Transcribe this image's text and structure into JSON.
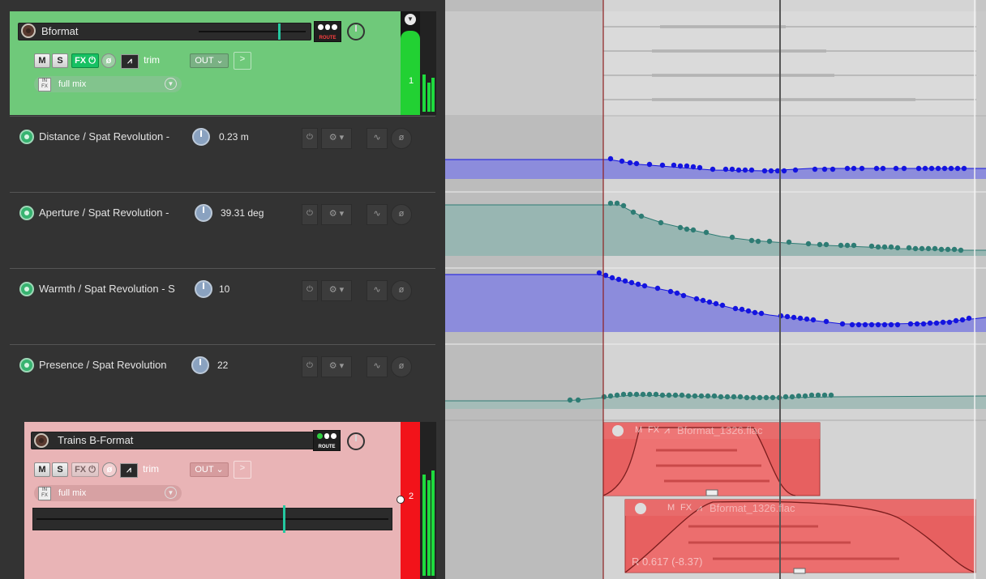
{
  "tracks": [
    {
      "name": "Bformat",
      "number": "1",
      "buttons": {
        "mute": "M",
        "solo": "S",
        "fx": "FX",
        "trim": "trim",
        "out": "OUT"
      },
      "route_label": "ROUTE",
      "fx_chain": "full mix",
      "fx_chip_label": "IN FX",
      "color": "#6fc97a",
      "fx_active": true
    },
    {
      "name": "Trains B-Format",
      "number": "2",
      "buttons": {
        "mute": "M",
        "solo": "S",
        "fx": "FX",
        "trim": "trim",
        "out": "OUT"
      },
      "route_label": "ROUTE",
      "fx_chain": "full mix",
      "fx_chip_label": "IN FX",
      "color": "#e9b4b6",
      "fx_active": false
    }
  ],
  "envelopes": [
    {
      "name": "Distance / Spat Revolution -",
      "value": "0.23 m"
    },
    {
      "name": "Aperture / Spat Revolution -",
      "value": "39.31 deg"
    },
    {
      "name": "Warmth / Spat Revolution - S",
      "value": "10"
    },
    {
      "name": "Presence / Spat Revolution",
      "value": "22"
    }
  ],
  "items": [
    {
      "title": "Bformat_1326.flac",
      "buttons": [
        "M",
        "FX"
      ]
    },
    {
      "title": "Bformat_1326.flac",
      "buttons": [
        "M",
        "FX"
      ],
      "rate_label": "R 0.617 (-8.37)"
    }
  ],
  "icons": {
    "track_record_arm": "record-arm-icon",
    "envelope_bypass": "power-icon",
    "phase": "phase-invert-icon",
    "envelope_shape": "envelope-icon",
    "settings": "gear-icon"
  },
  "colors": {
    "track1": "#6fc97a",
    "track2": "#e9b4b6",
    "envelope_blue": "#1414e0",
    "envelope_teal": "#2e7c74",
    "item_red": "#e65a5a"
  }
}
